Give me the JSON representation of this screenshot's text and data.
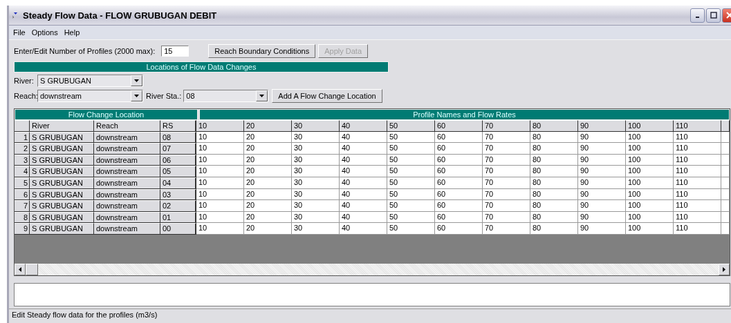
{
  "window": {
    "title": "Steady Flow Data - FLOW GRUBUGAN DEBIT"
  },
  "menu": [
    "File",
    "Options",
    "Help"
  ],
  "profiles_field": {
    "label": "Enter/Edit Number of Profiles (2000 max):",
    "value": "15"
  },
  "buttons": [
    {
      "label": "Reach Boundary Conditions",
      "disabled": false
    },
    {
      "label": "Apply Data",
      "disabled": true
    }
  ],
  "locations_header": "Locations of Flow Data Changes",
  "river": {
    "label": "River:",
    "value": "S GRUBUGAN"
  },
  "reach": {
    "label": "Reach:",
    "value": "downstream"
  },
  "river_sta": {
    "label": "River Sta.:",
    "value": "08"
  },
  "add_button": "Add A Flow Change Location",
  "table": {
    "left_caption": "Flow Change Location",
    "right_caption": "Profile Names and Flow Rates",
    "columns": [
      "River",
      "Reach",
      "RS"
    ],
    "profiles": [
      "10",
      "20",
      "30",
      "40",
      "50",
      "60",
      "70",
      "80",
      "90",
      "100",
      "110"
    ],
    "rows": [
      {
        "num": "1",
        "river": "S GRUBUGAN",
        "reach": "downstream",
        "rs": "08",
        "flows": [
          "10",
          "20",
          "30",
          "40",
          "50",
          "60",
          "70",
          "80",
          "90",
          "100",
          "110"
        ]
      },
      {
        "num": "2",
        "river": "S GRUBUGAN",
        "reach": "downstream",
        "rs": "07",
        "flows": [
          "10",
          "20",
          "30",
          "40",
          "50",
          "60",
          "70",
          "80",
          "90",
          "100",
          "110"
        ]
      },
      {
        "num": "3",
        "river": "S GRUBUGAN",
        "reach": "downstream",
        "rs": "06",
        "flows": [
          "10",
          "20",
          "30",
          "40",
          "50",
          "60",
          "70",
          "80",
          "90",
          "100",
          "110"
        ]
      },
      {
        "num": "4",
        "river": "S GRUBUGAN",
        "reach": "downstream",
        "rs": "05",
        "flows": [
          "10",
          "20",
          "30",
          "40",
          "50",
          "60",
          "70",
          "80",
          "90",
          "100",
          "110"
        ]
      },
      {
        "num": "5",
        "river": "S GRUBUGAN",
        "reach": "downstream",
        "rs": "04",
        "flows": [
          "10",
          "20",
          "30",
          "40",
          "50",
          "60",
          "70",
          "80",
          "90",
          "100",
          "110"
        ]
      },
      {
        "num": "6",
        "river": "S GRUBUGAN",
        "reach": "downstream",
        "rs": "03",
        "flows": [
          "10",
          "20",
          "30",
          "40",
          "50",
          "60",
          "70",
          "80",
          "90",
          "100",
          "110"
        ]
      },
      {
        "num": "7",
        "river": "S GRUBUGAN",
        "reach": "downstream",
        "rs": "02",
        "flows": [
          "10",
          "20",
          "30",
          "40",
          "50",
          "60",
          "70",
          "80",
          "90",
          "100",
          "110"
        ]
      },
      {
        "num": "8",
        "river": "S GRUBUGAN",
        "reach": "downstream",
        "rs": "01",
        "flows": [
          "10",
          "20",
          "30",
          "40",
          "50",
          "60",
          "70",
          "80",
          "90",
          "100",
          "110"
        ]
      },
      {
        "num": "9",
        "river": "S GRUBUGAN",
        "reach": "downstream",
        "rs": "00",
        "flows": [
          "10",
          "20",
          "30",
          "40",
          "50",
          "60",
          "70",
          "80",
          "90",
          "100",
          "110"
        ]
      }
    ]
  },
  "status_bar": "Edit Steady flow data for the profiles (m3/s)"
}
